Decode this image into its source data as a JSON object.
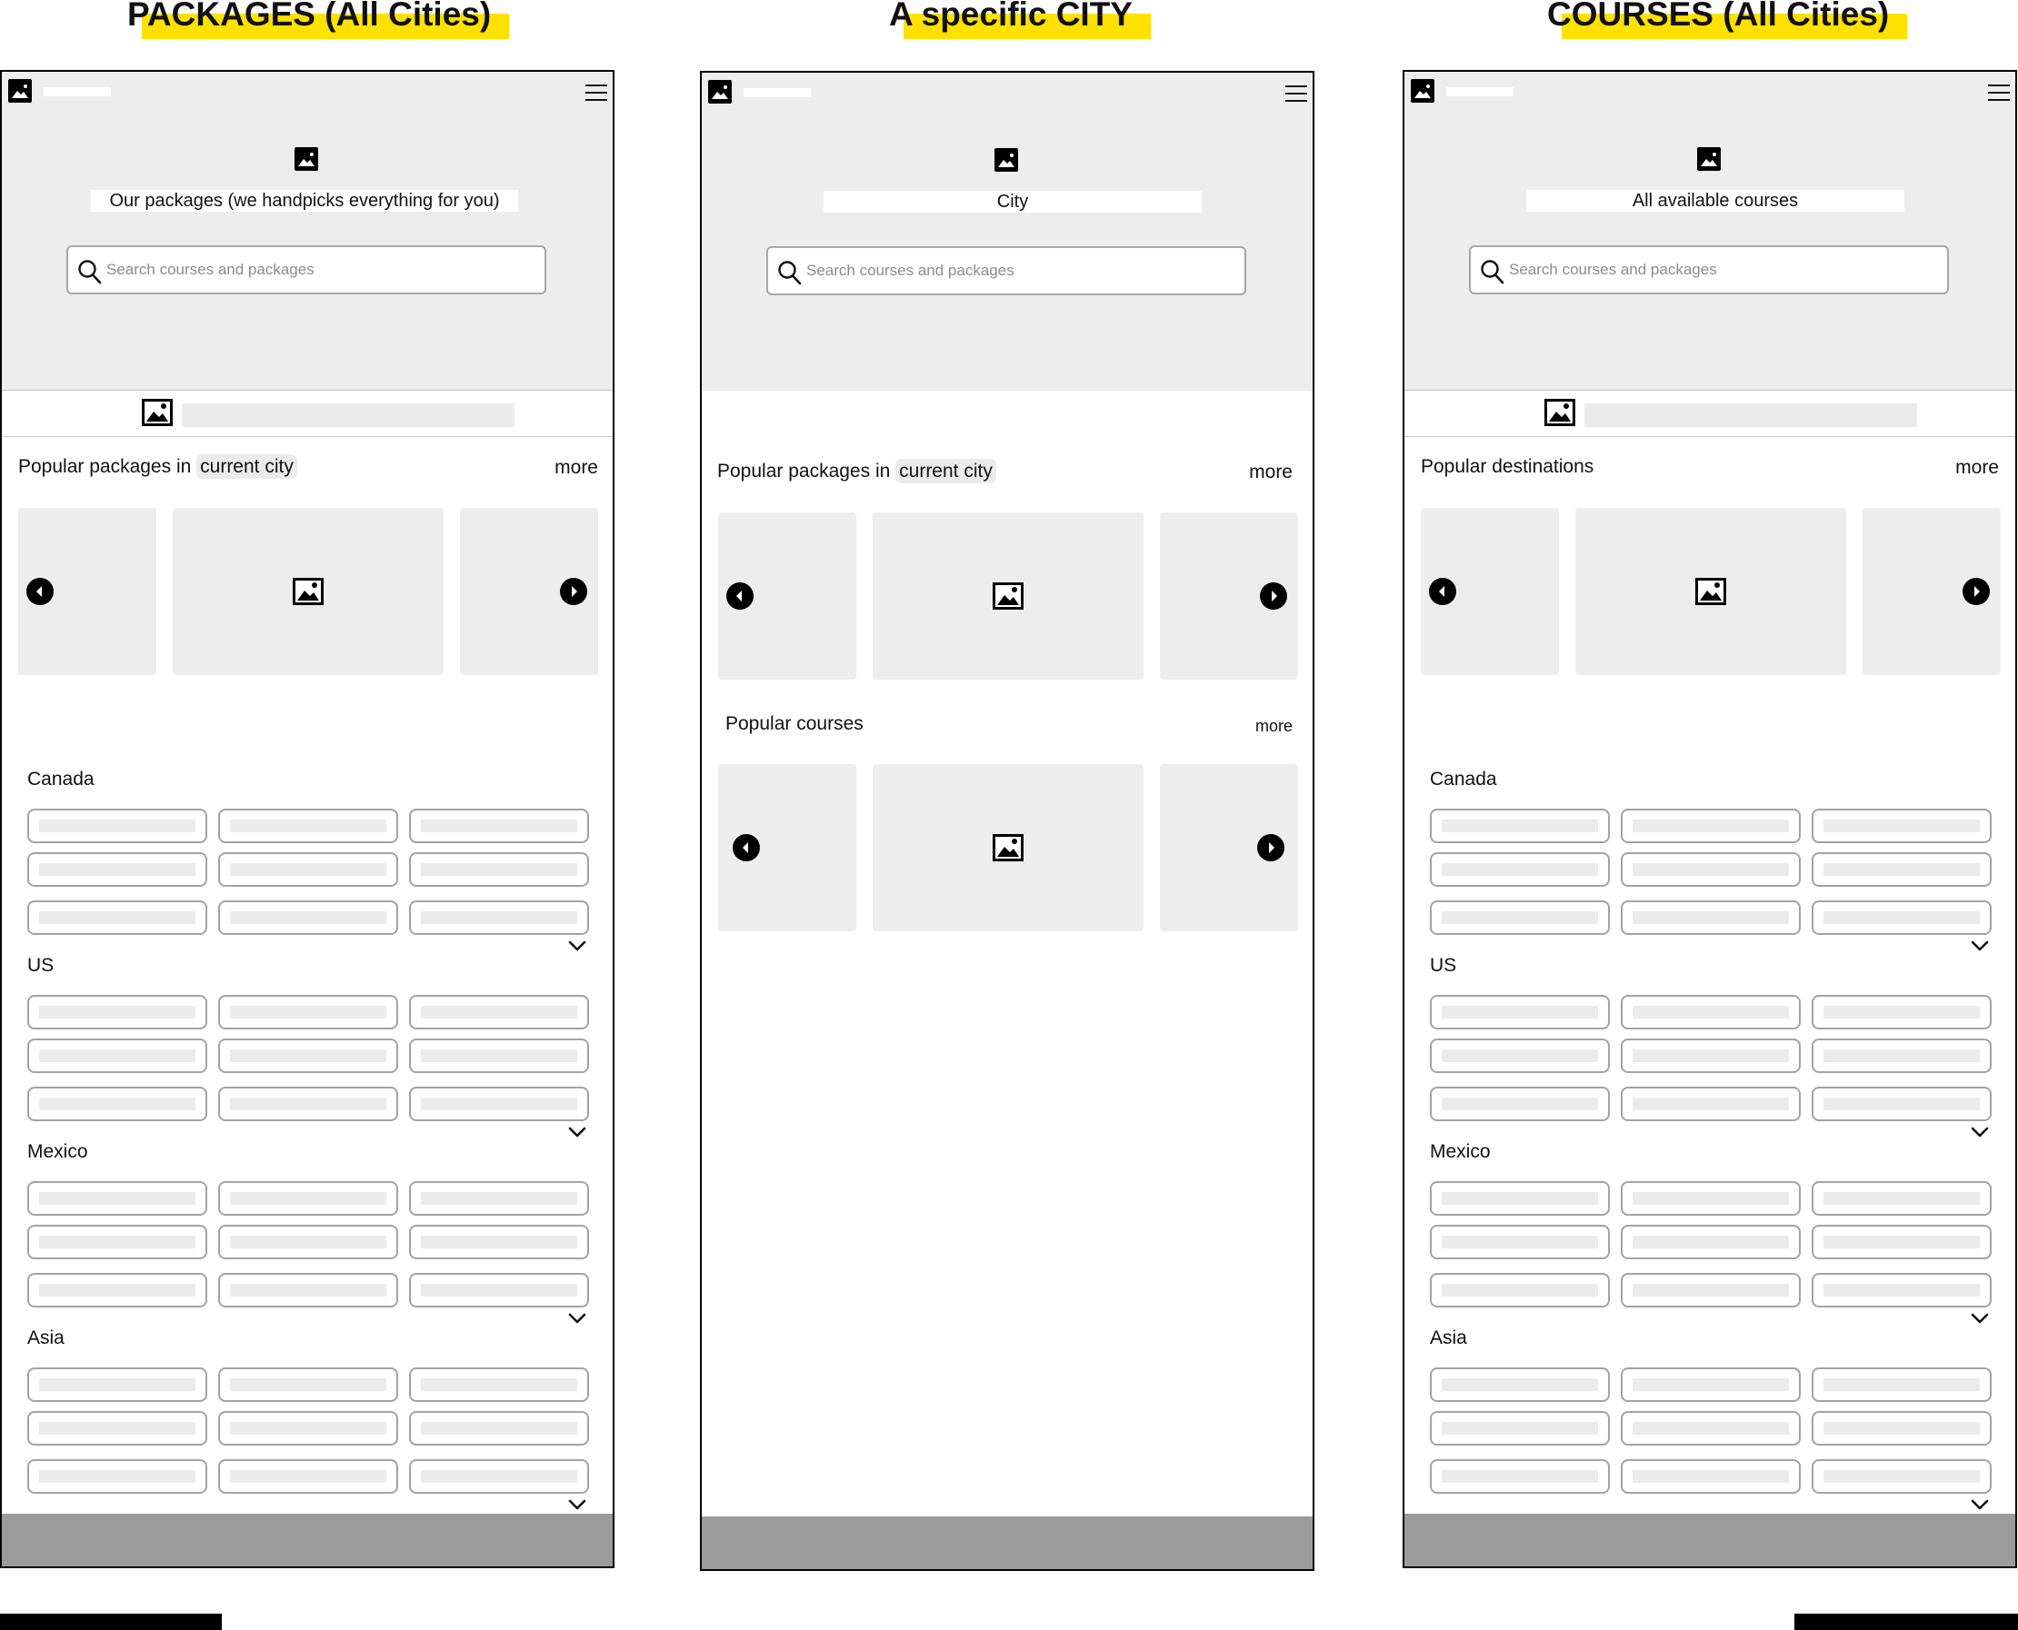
{
  "page_titles": [
    "PACKAGES (All Cities)",
    "A specific CITY",
    "COURSES (All Cities)"
  ],
  "screens": {
    "packages": {
      "hero_title": "Our packages (we handpicks everything for you)",
      "search_placeholder": "Search courses and packages",
      "popular_prefix": "Popular packages in",
      "popular_chip": "current city",
      "more": "more",
      "regions": [
        "Canada",
        "US",
        "Mexico",
        "Asia"
      ]
    },
    "city": {
      "hero_title": "City",
      "search_placeholder": "Search courses and packages",
      "popular_prefix": "Popular packages in",
      "popular_chip": "current city",
      "more": "more",
      "courses_title": "Popular courses",
      "courses_more": "more"
    },
    "courses": {
      "hero_title": "All available courses",
      "search_placeholder": "Search courses and packages",
      "popular_title": "Popular destinations",
      "more": "more",
      "regions": [
        "Canada",
        "US",
        "Mexico",
        "Asia"
      ]
    }
  },
  "icons": {
    "logo": "image-icon",
    "menu": "hamburger-menu-icon",
    "search": "search-icon",
    "prev": "chevron-left-circle-icon",
    "next": "chevron-right-circle-icon",
    "expand": "chevron-down-icon"
  },
  "colors": {
    "highlight": "#ffe100",
    "hero_bg": "#ededee",
    "placeholder": "#ebebeb",
    "footer": "#9b9b9b"
  }
}
